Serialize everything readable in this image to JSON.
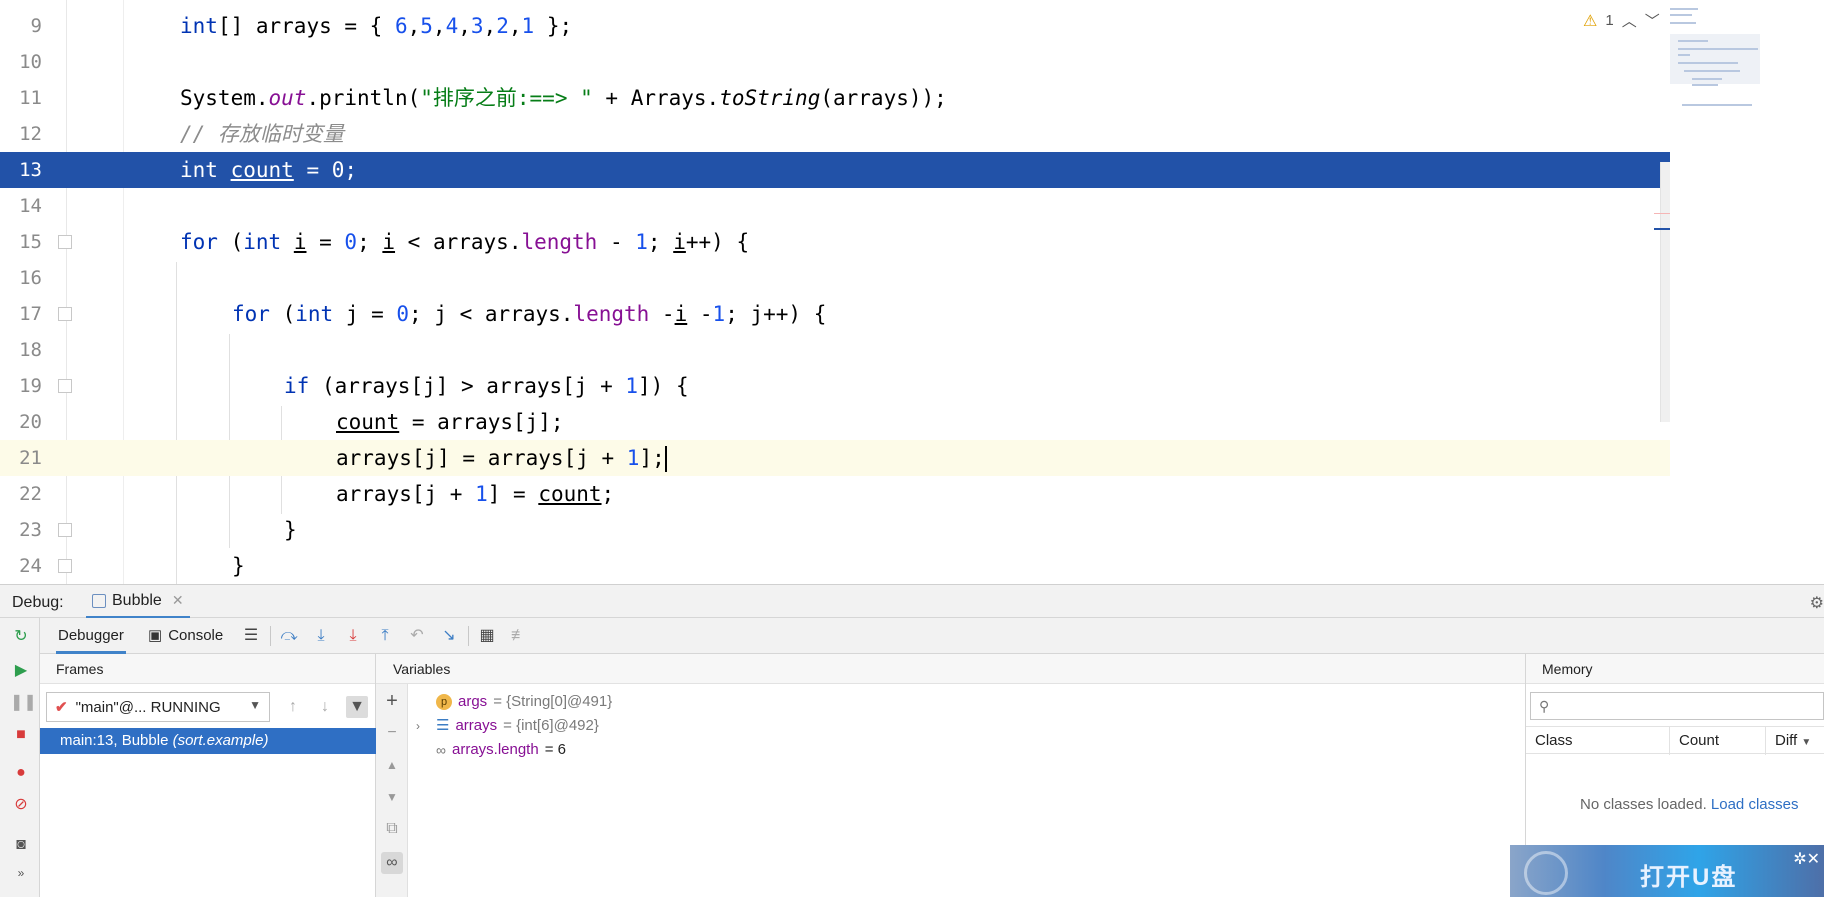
{
  "editor": {
    "lines": [
      {
        "num": "9"
      },
      {
        "num": "10"
      },
      {
        "num": "11"
      },
      {
        "num": "12"
      },
      {
        "num": "13"
      },
      {
        "num": "14"
      },
      {
        "num": "15"
      },
      {
        "num": "16"
      },
      {
        "num": "17"
      },
      {
        "num": "18"
      },
      {
        "num": "19"
      },
      {
        "num": "20"
      },
      {
        "num": "21"
      },
      {
        "num": "22"
      },
      {
        "num": "23"
      },
      {
        "num": "24"
      }
    ],
    "code": {
      "l9_a": "int",
      "l9_b": "[] arrays = { ",
      "l9_n1": "6",
      "l9_n2": "5",
      "l9_n3": "4",
      "l9_n4": "3",
      "l9_n5": "2",
      "l9_n6": "1",
      "l9_end": " };",
      "l11_a": "System.",
      "l11_out": "out",
      "l11_b": ".println(",
      "l11_str": "\"排序之前:==> \"",
      "l11_c": " + Arrays.",
      "l11_ts": "toString",
      "l11_d": "(arrays));",
      "l12_comment": "// 存放临时变量",
      "l13_a": "int ",
      "l13_var": "count",
      "l13_b": " = 0;",
      "l15_for": "for",
      "l15_a": " (",
      "l15_int": "int",
      "l15_i": "i",
      "l15_b": " = ",
      "l15_zero": "0",
      "l15_c": "; ",
      "l15_i2": "i",
      "l15_d": " < arrays.",
      "l15_len": "length",
      "l15_e": " - ",
      "l15_one": "1",
      "l15_f": "; ",
      "l15_i3": "i",
      "l15_g": "++) {",
      "l17_for": "for",
      "l17_a": " (",
      "l17_int": "int",
      "l17_b": " j = ",
      "l17_zero": "0",
      "l17_c": "; j < arrays.",
      "l17_len": "length",
      "l17_d": " -",
      "l17_i": "i",
      "l17_e": " -",
      "l17_one": "1",
      "l17_f": "; j++) {",
      "l19_if": "if",
      "l19_a": " (arrays[j] > arrays[j + ",
      "l19_one": "1",
      "l19_b": "]) {",
      "l20_var": "count",
      "l20_a": " = arrays[j];",
      "l21_a": "arrays[j] = arrays[j + ",
      "l21_one": "1",
      "l21_b": "];",
      "l22_a": "arrays[j + ",
      "l22_one": "1",
      "l22_b": "] = ",
      "l22_var": "count",
      "l22_c": ";",
      "l23": "}",
      "l24": "}"
    },
    "warning_count": "1"
  },
  "debug": {
    "label": "Debug:",
    "tab_name": "Bubble",
    "tabs": {
      "debugger": "Debugger",
      "console": "Console"
    }
  },
  "frames": {
    "title": "Frames",
    "thread": "\"main\"@... RUNNING",
    "frame_method": "main:13, Bubble ",
    "frame_package": "(sort.example)"
  },
  "variables": {
    "title": "Variables",
    "rows": [
      {
        "icon": "p",
        "name": "args",
        "value": " = {String[0]@491}"
      },
      {
        "icon": "list",
        "name": "arrays",
        "value": " = {int[6]@492}"
      },
      {
        "icon": "watch",
        "name": "arrays.length",
        "value": " = 6"
      }
    ]
  },
  "memory": {
    "title": "Memory",
    "columns": [
      "Class",
      "Count",
      "Diff"
    ],
    "empty_text": "No classes loaded. ",
    "load_link": "Load classes"
  },
  "banner": {
    "text": "打开U盘",
    "controls": "✲✕"
  },
  "colors": {
    "current_line": "#2252a8",
    "keyword": "#0033b3",
    "number": "#1750eb",
    "string": "#067d17",
    "field": "#871094",
    "selected_frame": "#2f6fc4"
  }
}
